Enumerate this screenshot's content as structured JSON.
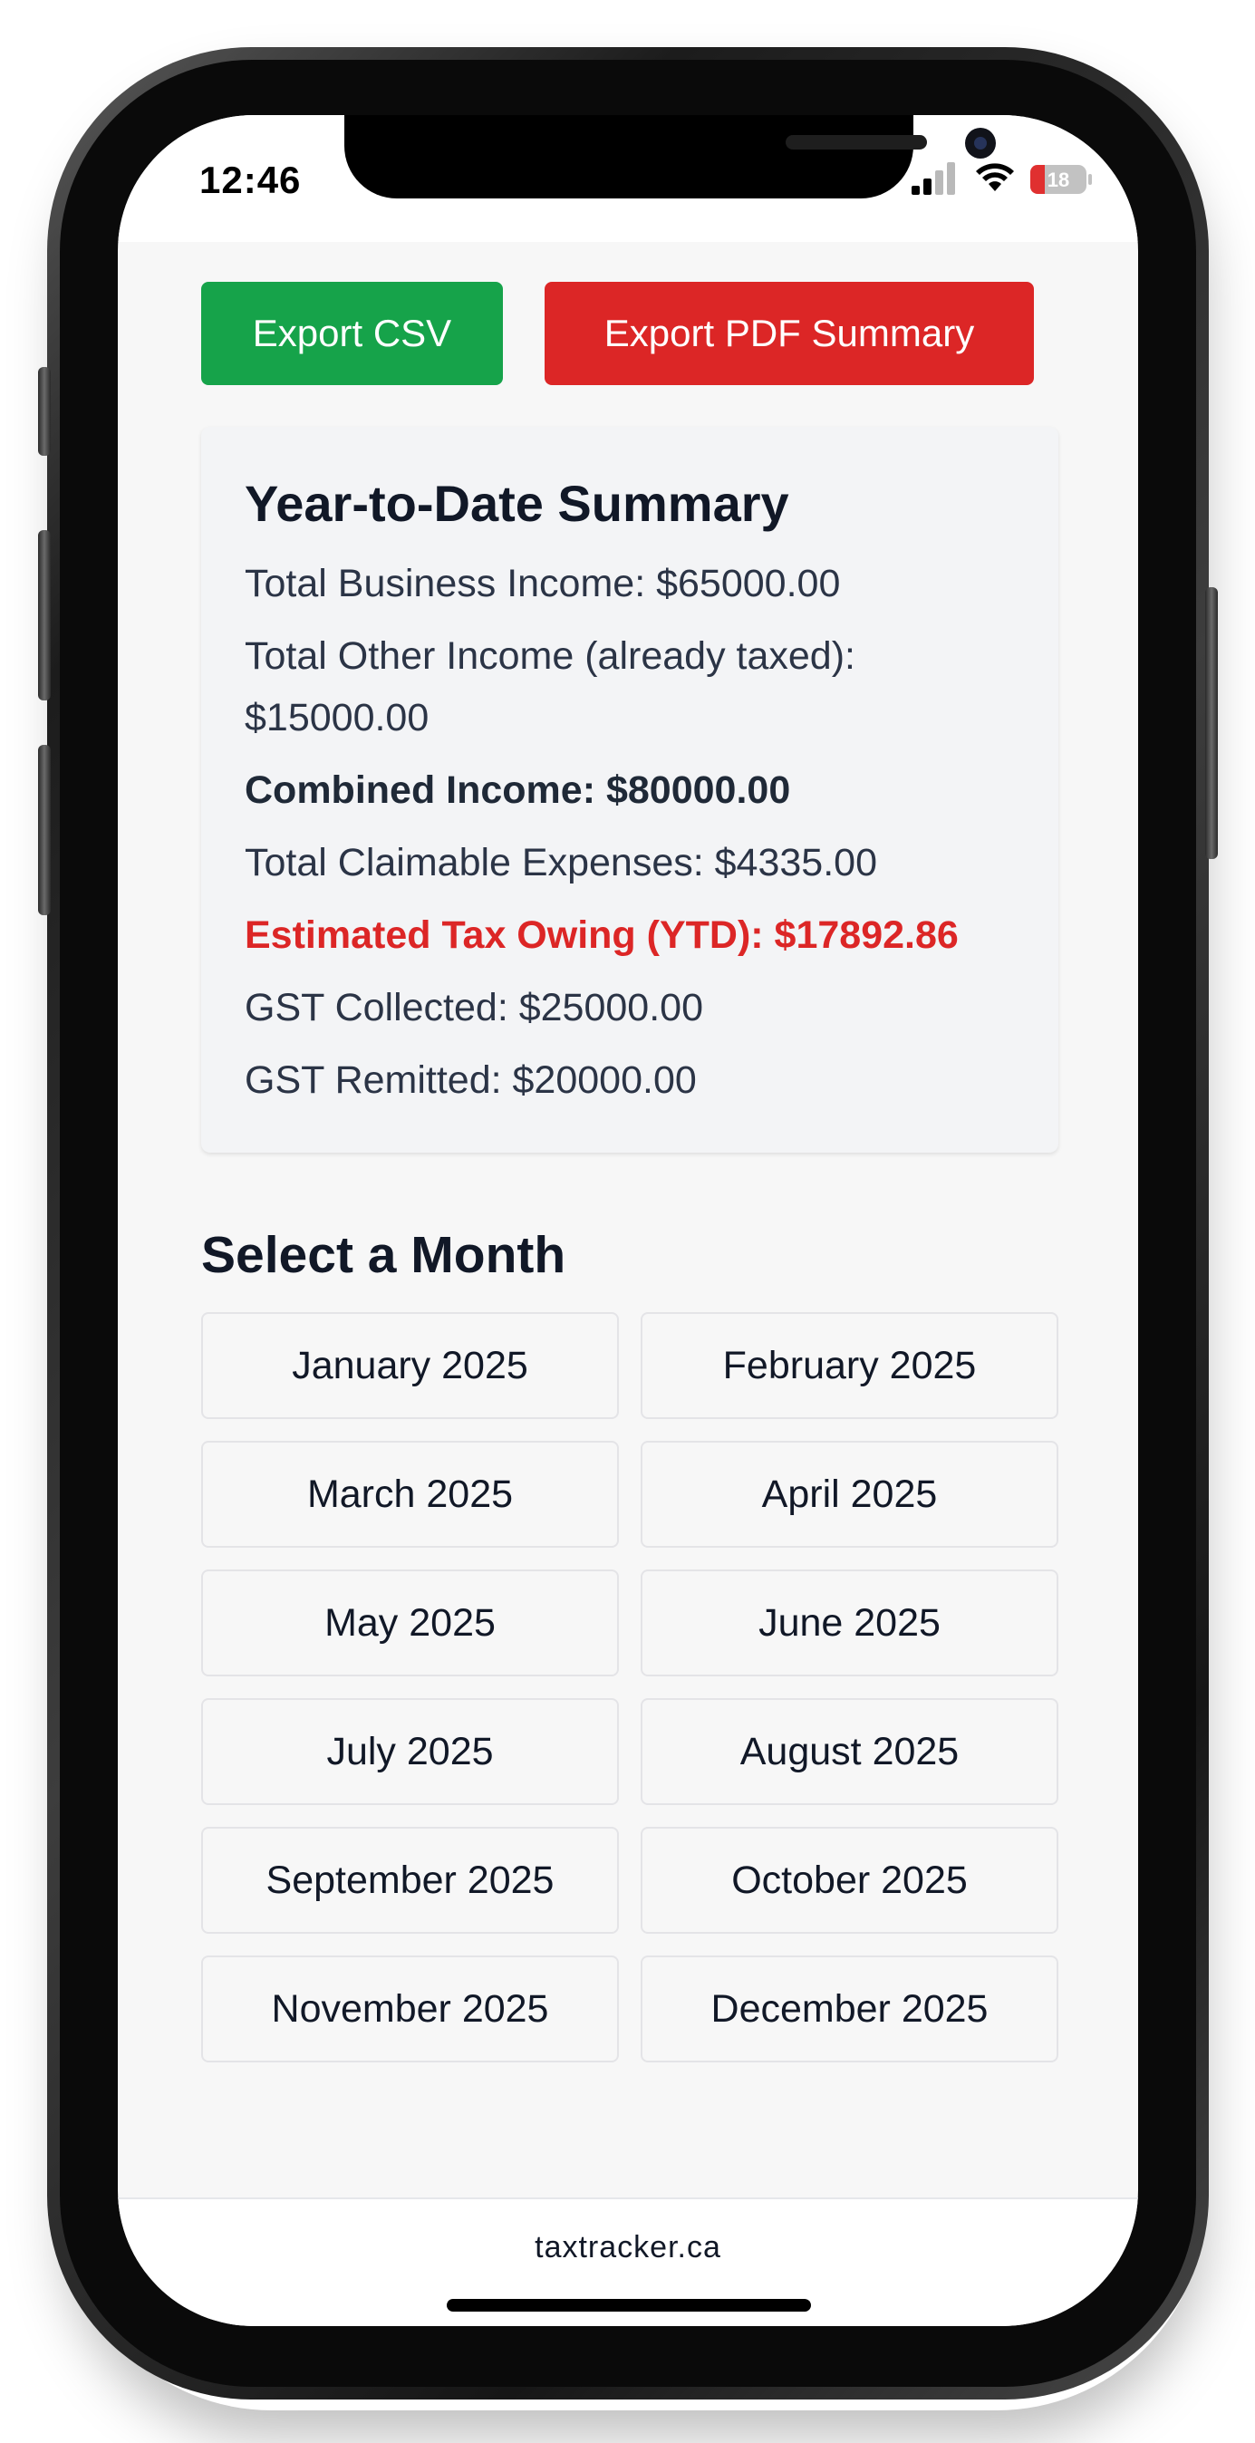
{
  "status_bar": {
    "time": "12:46",
    "battery_level": "18",
    "icons": [
      "signal-icon",
      "wifi-icon",
      "battery-icon"
    ]
  },
  "actions": {
    "export_csv": "Export CSV",
    "export_pdf": "Export PDF Summary"
  },
  "summary": {
    "title": "Year-to-Date Summary",
    "business_income": "Total Business Income: $65000.00",
    "other_income": "Total Other Income (already taxed): $15000.00",
    "combined_income": "Combined Income: $80000.00",
    "claimable_expenses": "Total Claimable Expenses: $4335.00",
    "estimated_tax": "Estimated Tax Owing (YTD): $17892.86",
    "gst_collected": "GST Collected: $25000.00",
    "gst_remitted": "GST Remitted: $20000.00"
  },
  "months": {
    "title": "Select a Month",
    "items": [
      "January 2025",
      "February 2025",
      "March 2025",
      "April 2025",
      "May 2025",
      "June 2025",
      "July 2025",
      "August 2025",
      "September 2025",
      "October 2025",
      "November 2025",
      "December 2025"
    ]
  },
  "footer": {
    "text": "taxtracker.ca"
  },
  "colors": {
    "csv_button": "#16a34a",
    "pdf_button": "#dc2626",
    "tax_owing_text": "#dc2626"
  }
}
